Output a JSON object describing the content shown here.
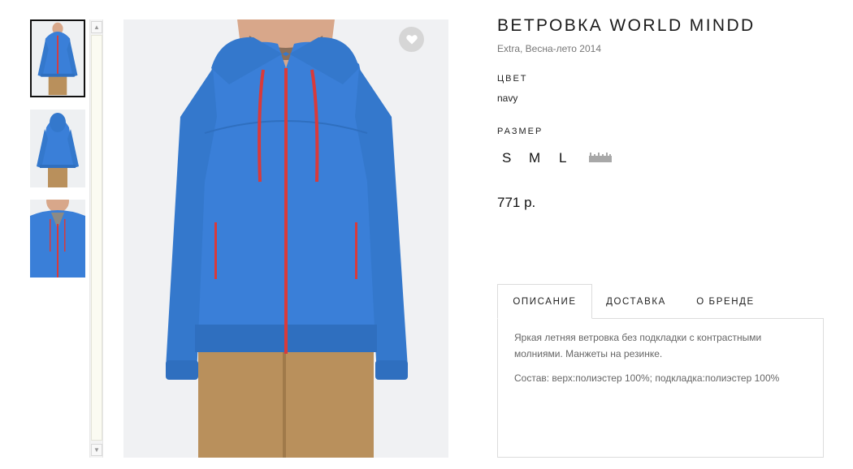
{
  "product": {
    "title": "ВЕТРОВКА WORLD MINDD",
    "subtitle": "Extra, Весна-лето 2014",
    "color_label": "ЦВЕТ",
    "color_value": "navy",
    "size_label": "РАЗМЕР",
    "sizes": [
      "S",
      "M",
      "L"
    ],
    "price": "771 р."
  },
  "tabs": {
    "items": [
      "ОПИСАНИЕ",
      "ДОСТАВКА",
      "О БРЕНДЕ"
    ],
    "active": "ОПИСАНИЕ"
  },
  "description": {
    "text": "Яркая летняя ветровка без подкладки с контрастными молниями. Манжеты на резинке.",
    "composition": "Состав: верх:полиэстер 100%; подкладка:полиэстер 100%"
  },
  "icons": {
    "favorite": "heart-icon",
    "size_chart": "ruler-icon",
    "scroll_up": "chevron-up-icon",
    "scroll_down": "chevron-down-icon"
  },
  "colors": {
    "jacket": "#3a7fd8",
    "zipper": "#d93a3a",
    "pants": "#b9905c",
    "image_bg": "#f0f1f3",
    "fav_button": "#d6d6d6"
  }
}
